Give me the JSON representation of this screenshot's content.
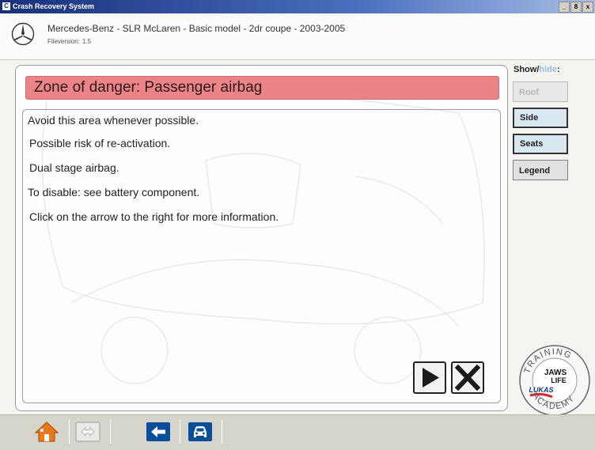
{
  "window": {
    "title": "Crash Recovery System",
    "icon_letter": "C",
    "controls": [
      "_",
      "8",
      "x"
    ]
  },
  "header": {
    "vehicle": "Mercedes-Benz - SLR McLaren - Basic model - 2dr coupe - 2003-2005",
    "fileversion_label": "Fileversion:",
    "fileversion": "1.5"
  },
  "danger": {
    "title": "Zone of danger: Passenger airbag"
  },
  "lines": [
    "Avoid this area whenever possible.",
    "Possible risk of re-activation.",
    "Dual stage airbag.",
    "To disable: see battery component.",
    "Click on the arrow to the right for more information."
  ],
  "sidebar": {
    "show": "Show",
    "slash": "/",
    "hide": "hide",
    "colon": ":",
    "buttons": [
      "Roof",
      "Side",
      "Seats",
      "Legend"
    ]
  },
  "badge": {
    "top": "TRAINING",
    "brand1": "JAWS",
    "brand2": "LIFE",
    "brand3": "LUKAS",
    "bottom": "ACADEMY"
  },
  "colors": {
    "danger": "#ec8487",
    "button_selected": "#d9e7f0",
    "hide_text": "#9db9e2",
    "home_orange": "#e87a1c",
    "nav_blue": "#0b4f9c"
  },
  "icons": [
    "home-icon",
    "swap-icon",
    "back-arrow-icon",
    "car-icon",
    "play-arrow-icon",
    "close-icon"
  ]
}
